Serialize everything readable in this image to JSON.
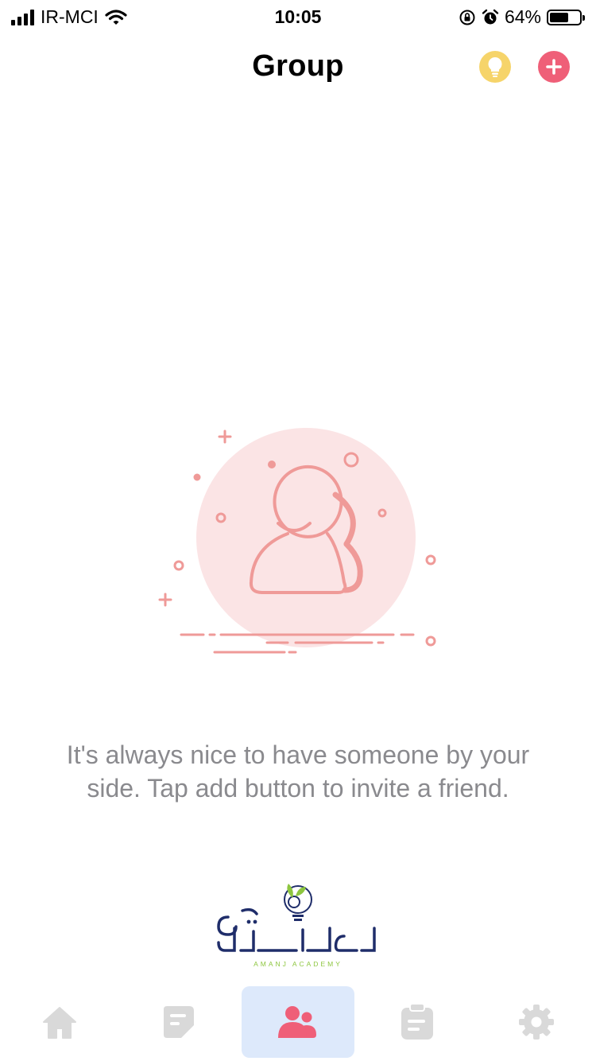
{
  "status_bar": {
    "carrier": "IR-MCI",
    "time": "10:05",
    "battery_percent": "64%",
    "battery_level": 0.64
  },
  "header": {
    "title": "Group",
    "tip_icon": "lightbulb-icon",
    "add_icon": "plus-icon"
  },
  "empty_state": {
    "message": "It's always nice to have someone by your side. Tap add button to invite a friend.",
    "illustration": "group-people-icon"
  },
  "brand": {
    "logo_caption": "AMANJ ACADEMY"
  },
  "tab_bar": {
    "items": [
      {
        "icon": "home-icon",
        "active": false
      },
      {
        "icon": "notes-icon",
        "active": false
      },
      {
        "icon": "group-icon",
        "active": true
      },
      {
        "icon": "clipboard-icon",
        "active": false
      },
      {
        "icon": "gear-icon",
        "active": false
      }
    ]
  },
  "colors": {
    "accent_pink": "#ef5f78",
    "tip_yellow": "#f6d46a",
    "illustration_stroke": "#ef9a98",
    "illustration_circle": "#fbe4e5",
    "tab_inactive": "#d9d9d9",
    "tab_active_bg": "#dde9fb",
    "message_gray": "#8a8a8e"
  }
}
